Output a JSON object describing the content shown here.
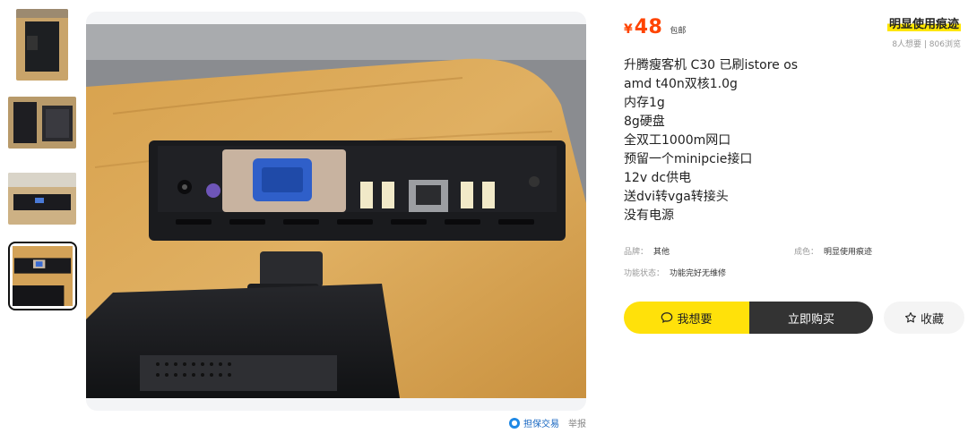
{
  "price": {
    "symbol": "¥",
    "value": "48",
    "shipping": "包邮"
  },
  "condition_tag": "明显使用痕迹",
  "stats": "8人想要 | 806浏览",
  "description": [
    "升腾瘦客机 C30 已刷istore os",
    "amd t40n双核1.0g",
    "内存1g",
    "8g硬盘",
    "全双工1000m网口",
    "预留一个minipcie接口",
    "12v dc供电",
    "送dvi转vga转接头",
    "没有电源"
  ],
  "attributes": {
    "brand_label": "品牌：",
    "brand_value": "其他",
    "condition_label": "成色：",
    "condition_value": "明显使用痕迹",
    "function_label": "功能状态：",
    "function_value": "功能完好无维修"
  },
  "actions": {
    "want": "我想要",
    "buy": "立即购买",
    "favorite": "收藏"
  },
  "footer": {
    "guarantee": "担保交易",
    "report": "举报"
  },
  "icons": {
    "want": "chat-bubble-icon",
    "favorite": "star-icon",
    "guarantee": "shield-user-icon"
  },
  "colors": {
    "price": "#ff4400",
    "want_bg": "#ffe10a",
    "buy_bg": "#333333",
    "highlight": "#ffe600"
  },
  "thumbnails": {
    "count": 4,
    "selected": 4
  }
}
